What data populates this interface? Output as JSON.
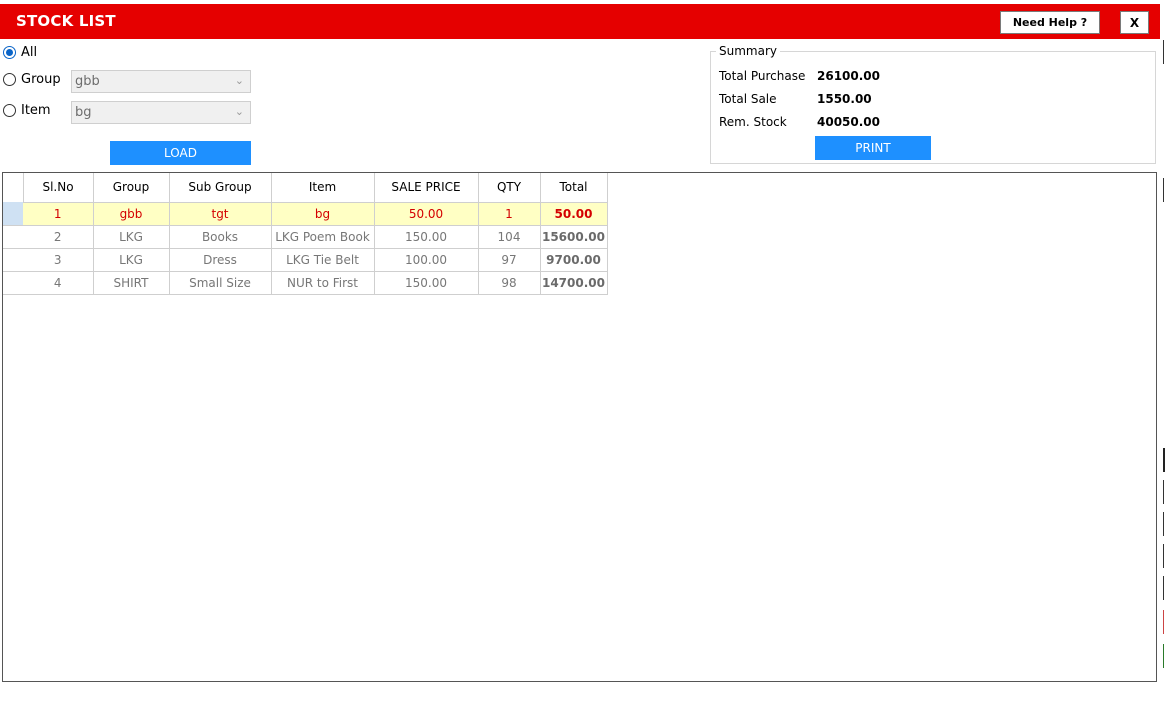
{
  "window": {
    "title": "STOCK LIST",
    "help_label": "Need Help ?",
    "close_label": "X"
  },
  "filters": {
    "all_label": "All",
    "group_label": "Group",
    "item_label": "Item",
    "group_value": "gbb",
    "item_value": "bg",
    "selected": "All",
    "load_label": "LOAD"
  },
  "summary": {
    "legend": "Summary",
    "total_purchase_label": "Total Purchase",
    "total_purchase": "26100.00",
    "total_sale_label": "Total Sale",
    "total_sale": "1550.00",
    "rem_stock_label": "Rem. Stock",
    "rem_stock": "40050.00",
    "print_label": "PRINT"
  },
  "table": {
    "columns": [
      "Sl.No",
      "Group",
      "Sub Group",
      "Item",
      "SALE PRICE",
      "QTY",
      "Total"
    ],
    "rows": [
      [
        "1",
        "gbb",
        "tgt",
        "bg",
        "50.00",
        "1",
        "50.00"
      ],
      [
        "2",
        "LKG",
        "Books",
        "LKG Poem Book",
        "150.00",
        "104",
        "15600.00"
      ],
      [
        "3",
        "LKG",
        "Dress",
        "LKG Tie Belt",
        "100.00",
        "97",
        "9700.00"
      ],
      [
        "4",
        "SHIRT",
        "Small Size",
        "NUR to First",
        "150.00",
        "98",
        "14700.00"
      ]
    ],
    "selected_row": 0
  },
  "colors": {
    "titlebar": "#e50000",
    "button": "#1e90ff",
    "selected_row": "#ffffc4",
    "selected_text": "#d40000"
  }
}
